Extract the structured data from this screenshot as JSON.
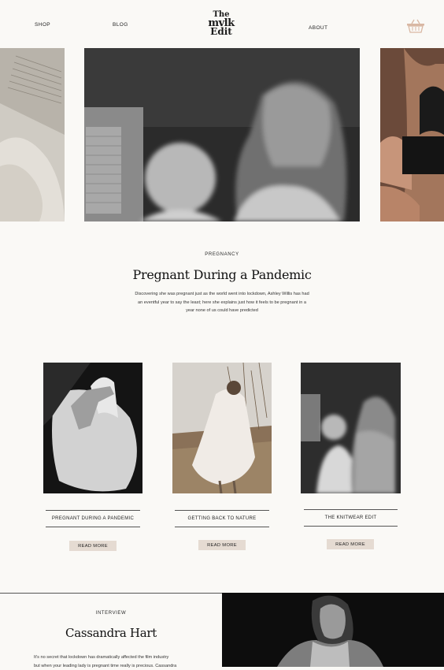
{
  "header": {
    "nav_left": [
      "SHOP",
      "BLOG"
    ],
    "nav_right": "ABOUT",
    "logo_line1": "The",
    "logo_line2": "mvlk",
    "logo_line3": "Edit",
    "basket_icon": "basket-icon"
  },
  "hero": {
    "category": "PREGNANCY",
    "title": "Pregnant During a Pandemic",
    "description_lines": [
      "Discovering she was pregnant just as the world went into lockdown, Ashley Willis has had",
      "an eventful year to say the least; here she explains just how it feels to be pregnant in a",
      "year none of us could have predicted"
    ]
  },
  "cards": [
    {
      "title": "PREGNANT DURING A PANDEMIC",
      "button": "READ MORE"
    },
    {
      "title": "GETTING BACK TO NATURE",
      "button": "READ MORE"
    },
    {
      "title": "THE KNITWEAR EDIT",
      "button": "READ MORE"
    }
  ],
  "interview": {
    "category": "INTERVIEW",
    "name": "Cassandra Hart",
    "text_line1": "It's no secret that lockdown has dramatically affected the film industry",
    "text_line2": "but when your leading lady is pregnant time really is precious. Cassandra"
  },
  "colors": {
    "background": "#faf9f6",
    "button_bg": "#e5dbd2",
    "text": "#1b1b1b",
    "basket": "#d9b8a4"
  }
}
